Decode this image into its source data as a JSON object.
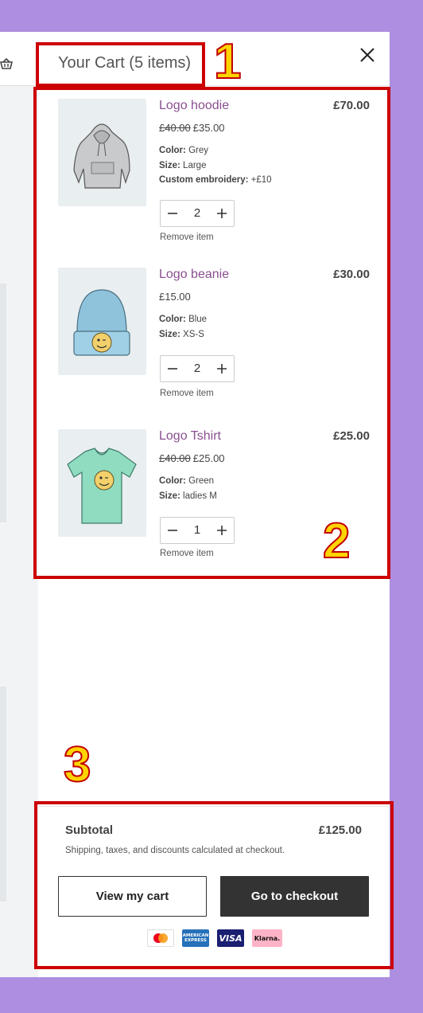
{
  "cart": {
    "title": "Your Cart (5 items)",
    "close_label": "×"
  },
  "items": [
    {
      "name": "Logo hoodie",
      "total": "£70.00",
      "old_price": "£40.00",
      "price": "£35.00",
      "meta": [
        {
          "label": "Color:",
          "value": "Grey"
        },
        {
          "label": "Size:",
          "value": "Large"
        },
        {
          "label": "Custom embroidery:",
          "value": "+£10"
        }
      ],
      "quantity": "2",
      "remove_label": "Remove item",
      "image_color": "#c9cacb"
    },
    {
      "name": "Logo beanie",
      "total": "£30.00",
      "old_price": "",
      "price": "£15.00",
      "meta": [
        {
          "label": "Color:",
          "value": "Blue"
        },
        {
          "label": "Size:",
          "value": "XS-S"
        }
      ],
      "quantity": "2",
      "remove_label": "Remove item",
      "image_color": "#8fc3dc"
    },
    {
      "name": "Logo Tshirt",
      "total": "£25.00",
      "old_price": "£40.00",
      "price": "£25.00",
      "meta": [
        {
          "label": "Color:",
          "value": "Green"
        },
        {
          "label": "Size:",
          "value": "ladies M"
        }
      ],
      "quantity": "1",
      "remove_label": "Remove item",
      "image_color": "#8fdcc0"
    }
  ],
  "footer": {
    "subtotal_label": "Subtotal",
    "subtotal_value": "£125.00",
    "shipping_note": "Shipping, taxes, and discounts calculated at checkout.",
    "view_cart_label": "View my cart",
    "checkout_label": "Go to checkout",
    "payment_icons": [
      "mastercard",
      "american-express",
      "visa",
      "klarna"
    ],
    "amex_text": "AMERICAN EXPRESS",
    "visa_text": "VISA",
    "klarna_text": "Klarna."
  },
  "annotations": [
    "1",
    "2",
    "3"
  ],
  "colors": {
    "background": "#ad8ee0",
    "product_link": "#8a4f8f",
    "checkout_button": "#333333",
    "annotation_box": "#cc0000",
    "annotation_number": "#ffd400"
  }
}
